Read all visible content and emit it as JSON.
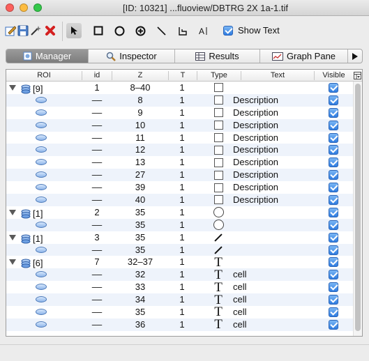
{
  "window": {
    "title": "[ID: 10321] ...fluoview/DBTRG 2X 1a-1.tif"
  },
  "toolbar": {
    "tools": [
      "edit-icon",
      "save-icon",
      "wand-icon",
      "delete-icon",
      "pointer-icon",
      "rectangle-icon",
      "ellipse-icon",
      "crosshair-icon",
      "line-icon",
      "polyline-icon",
      "text-tool-icon"
    ],
    "show_text_label": "Show Text",
    "show_text_checked": true
  },
  "tabs": [
    {
      "label": "Manager",
      "icon": "manager-icon",
      "selected": true
    },
    {
      "label": "Inspector",
      "icon": "magnifier-icon",
      "selected": false
    },
    {
      "label": "Results",
      "icon": "table-icon",
      "selected": false
    },
    {
      "label": "Graph Pane",
      "icon": "graph-icon",
      "selected": false
    }
  ],
  "table": {
    "headers": {
      "roi": "ROI",
      "id": "id",
      "z": "Z",
      "t": "T",
      "type": "Type",
      "text": "Text",
      "visible": "Visible"
    },
    "rows": [
      {
        "kind": "group",
        "roi": "[9]",
        "id": "1",
        "z": "8–40",
        "t": "1",
        "type": "square",
        "text": "",
        "visible": true
      },
      {
        "kind": "child",
        "roi": "",
        "id": "––",
        "z": "8",
        "t": "1",
        "type": "square",
        "text": "Description",
        "visible": true
      },
      {
        "kind": "child",
        "roi": "",
        "id": "––",
        "z": "9",
        "t": "1",
        "type": "square",
        "text": "Description",
        "visible": true
      },
      {
        "kind": "child",
        "roi": "",
        "id": "––",
        "z": "10",
        "t": "1",
        "type": "square",
        "text": "Description",
        "visible": true
      },
      {
        "kind": "child",
        "roi": "",
        "id": "––",
        "z": "11",
        "t": "1",
        "type": "square",
        "text": "Description",
        "visible": true
      },
      {
        "kind": "child",
        "roi": "",
        "id": "––",
        "z": "12",
        "t": "1",
        "type": "square",
        "text": "Description",
        "visible": true
      },
      {
        "kind": "child",
        "roi": "",
        "id": "––",
        "z": "13",
        "t": "1",
        "type": "square",
        "text": "Description",
        "visible": true
      },
      {
        "kind": "child",
        "roi": "",
        "id": "––",
        "z": "27",
        "t": "1",
        "type": "square",
        "text": "Description",
        "visible": true
      },
      {
        "kind": "child",
        "roi": "",
        "id": "––",
        "z": "39",
        "t": "1",
        "type": "square",
        "text": "Description",
        "visible": true
      },
      {
        "kind": "child",
        "roi": "",
        "id": "––",
        "z": "40",
        "t": "1",
        "type": "square",
        "text": "Description",
        "visible": true
      },
      {
        "kind": "group",
        "roi": "[1]",
        "id": "2",
        "z": "35",
        "t": "1",
        "type": "circle",
        "text": "",
        "visible": true
      },
      {
        "kind": "child",
        "roi": "",
        "id": "––",
        "z": "35",
        "t": "1",
        "type": "circle",
        "text": "",
        "visible": true
      },
      {
        "kind": "group",
        "roi": "[1]",
        "id": "3",
        "z": "35",
        "t": "1",
        "type": "line",
        "text": "",
        "visible": true
      },
      {
        "kind": "child",
        "roi": "",
        "id": "––",
        "z": "35",
        "t": "1",
        "type": "line",
        "text": "",
        "visible": true
      },
      {
        "kind": "group",
        "roi": "[6]",
        "id": "7",
        "z": "32–37",
        "t": "1",
        "type": "text",
        "text": "",
        "visible": true
      },
      {
        "kind": "child",
        "roi": "",
        "id": "––",
        "z": "32",
        "t": "1",
        "type": "text",
        "text": "cell",
        "visible": true
      },
      {
        "kind": "child",
        "roi": "",
        "id": "––",
        "z": "33",
        "t": "1",
        "type": "text",
        "text": "cell",
        "visible": true
      },
      {
        "kind": "child",
        "roi": "",
        "id": "––",
        "z": "34",
        "t": "1",
        "type": "text",
        "text": "cell",
        "visible": true
      },
      {
        "kind": "child",
        "roi": "",
        "id": "––",
        "z": "35",
        "t": "1",
        "type": "text",
        "text": "cell",
        "visible": true
      },
      {
        "kind": "child",
        "roi": "",
        "id": "––",
        "z": "36",
        "t": "1",
        "type": "text",
        "text": "cell",
        "visible": true
      }
    ]
  },
  "type_glyph": {
    "text": "T"
  }
}
